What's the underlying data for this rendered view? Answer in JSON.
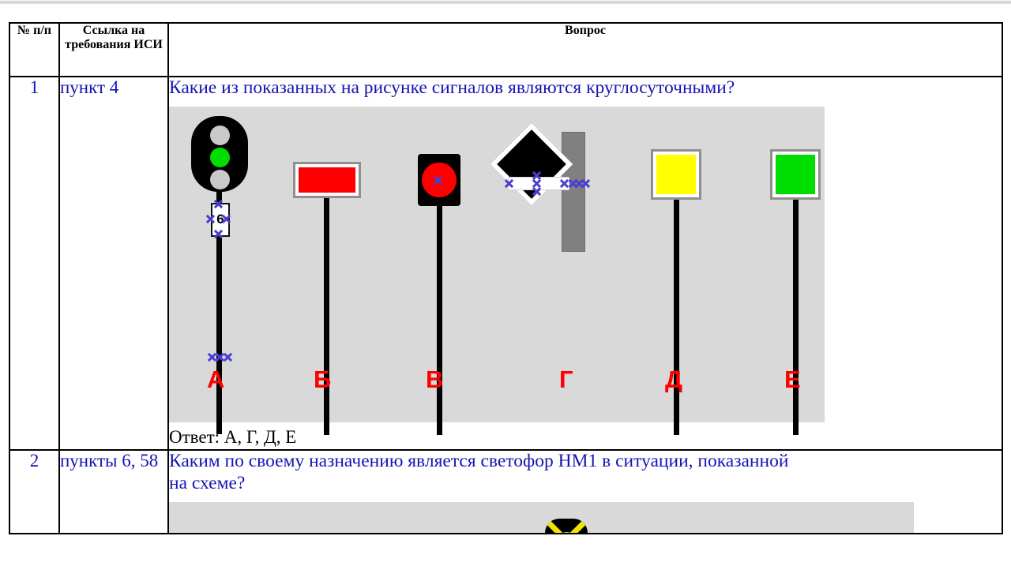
{
  "document": {
    "table": {
      "headers": [
        "№ п/п",
        "Ссылка на требования ИСИ",
        "Вопрос"
      ],
      "rows": [
        {
          "number": "1",
          "reference": "пункт 4",
          "question": "Какие из показанных на рисунке сигналов являются круглосуточными?",
          "answer": "Ответ: А, Г, Д, Е",
          "figure": {
            "background_color": "#d9d9d9",
            "signals": [
              {
                "label": "А",
                "type": "three-lamp-head",
                "lamps": [
                  "gray",
                  "green",
                  "gray"
                ],
                "lamp_colors": [
                  "#c9c9c9",
                  "#00dd00",
                  "#c9c9c9"
                ],
                "plate_number": "6",
                "selected": true
              },
              {
                "label": "Б",
                "type": "rectangular-board",
                "color": "#ff0000",
                "selected": false
              },
              {
                "label": "В",
                "type": "black-box-red-disc",
                "color": "#ff0000",
                "selected": true
              },
              {
                "label": "Г",
                "type": "diamond-with-white-bar",
                "color": "#000000",
                "has_gray_post": true,
                "selected": true
              },
              {
                "label": "Д",
                "type": "square-board",
                "color": "#ffff00",
                "selected": false
              },
              {
                "label": "Е",
                "type": "square-board",
                "color": "#00dd00",
                "selected": false
              }
            ]
          }
        },
        {
          "number": "2",
          "reference": "пункты 6, 58",
          "question": "Каким по своему назначению является светофор НМ1 в ситуации, показанной\nна схеме?",
          "answer": "",
          "figure": {
            "background_color": "#d9d9d9",
            "signals": [
              {
                "label": "",
                "type": "x-signal-head",
                "color": "#f2e400",
                "selected": false
              }
            ]
          }
        }
      ]
    }
  }
}
